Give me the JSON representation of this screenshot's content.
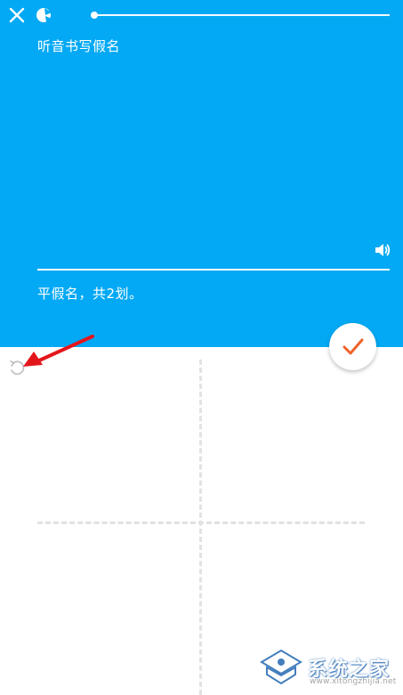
{
  "header": {
    "close_icon": "close-icon",
    "mascot_icon": "mascot-icon",
    "progress_fraction": 0.0
  },
  "prompt": {
    "title": "听音书写假名",
    "speaker_icon": "speaker-icon",
    "hint": "平假名，共2划。"
  },
  "actions": {
    "submit_icon": "checkmark-icon",
    "undo_icon": "undo-icon"
  },
  "watermark": {
    "text": "系统之家",
    "url": "www.xitongzhijia.net"
  },
  "colors": {
    "panel": "#03a9f4",
    "checkmark": "#f0622a",
    "annotation_arrow": "#e3161b",
    "grid": "#e2e2e2"
  }
}
